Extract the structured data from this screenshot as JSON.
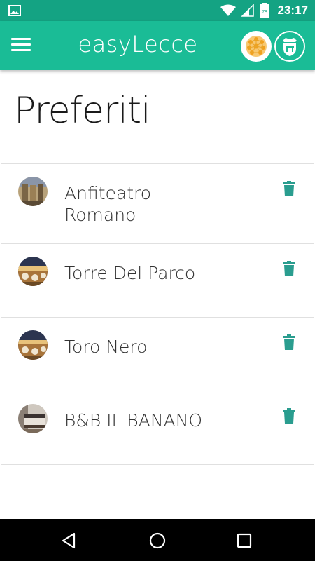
{
  "status_bar": {
    "time": "23:17",
    "battery_level": "78",
    "icons": [
      "image-notification-icon",
      "wifi-icon",
      "signal-icon",
      "battery-icon"
    ]
  },
  "app_bar": {
    "title": "easyLecce",
    "menu_icon": "hamburger-menu-icon",
    "logos": [
      "easylecce-logo",
      "lecce-coat-of-arms-logo"
    ]
  },
  "page": {
    "title": "Preferiti"
  },
  "favorites": [
    {
      "name": "Anfiteatro Romano",
      "thumbnail": "amphitheatre-photo"
    },
    {
      "name": "Torre Del Parco",
      "thumbnail": "restaurant-photo"
    },
    {
      "name": "Toro Nero",
      "thumbnail": "restaurant-photo"
    },
    {
      "name": "B&B IL BANANO",
      "thumbnail": "bedroom-photo"
    }
  ],
  "nav_bar": {
    "buttons": [
      "back-button",
      "home-button",
      "recents-button"
    ]
  },
  "colors": {
    "status_bar": "#14a383",
    "app_bar": "#1abc96",
    "accent": "#2a9d8f",
    "background": "#ffffff"
  }
}
